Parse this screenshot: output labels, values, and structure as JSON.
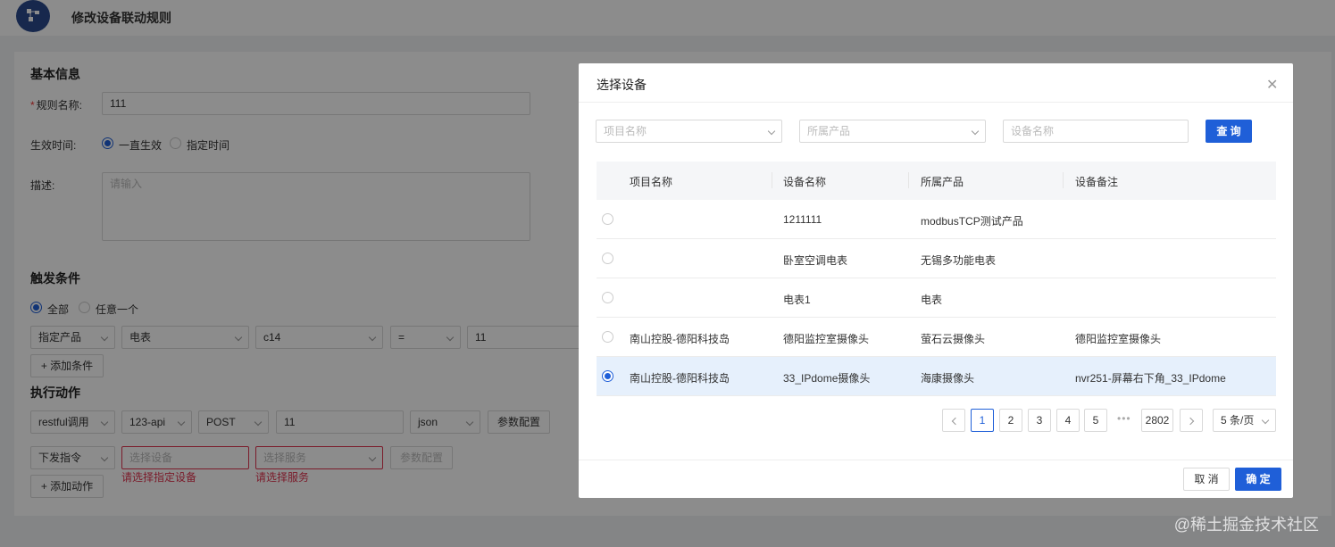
{
  "header": {
    "title": "修改设备联动规则",
    "logo_icon": "flow-icon"
  },
  "form": {
    "basic_title": "基本信息",
    "rule_name_label": "规则名称:",
    "rule_name_value": "111",
    "effective_label": "生效时间:",
    "effective_options": [
      "一直生效",
      "指定时间"
    ],
    "desc_label": "描述:",
    "desc_placeholder": "请输入",
    "trigger_title": "触发条件",
    "trigger_options": [
      "全部",
      "任意一个"
    ],
    "trigger_row": [
      "指定产品",
      "电表",
      "c14",
      "=",
      "11"
    ],
    "add_condition": "+ 添加条件",
    "action_title": "执行动作",
    "action_row1": [
      "restful调用",
      "123-api",
      "POST",
      "11",
      "json"
    ],
    "param_button": "参数配置",
    "action_row2_type": "下发指令",
    "select_device_ph": "选择设备",
    "select_service_ph": "选择服务",
    "error_device": "请选择指定设备",
    "error_service": "请选择服务",
    "add_action": "+ 添加动作"
  },
  "modal": {
    "title": "选择设备",
    "filters": {
      "project_ph": "项目名称",
      "product_ph": "所属产品",
      "device_ph": "设备名称",
      "query_button": "查 询"
    },
    "columns": [
      "项目名称",
      "设备名称",
      "所属产品",
      "设备备注"
    ],
    "rows": [
      {
        "project": "",
        "device": "1211111",
        "product": "modbusTCP测试产品",
        "remark": ""
      },
      {
        "project": "",
        "device": "卧室空调电表",
        "product": "无锡多功能电表",
        "remark": ""
      },
      {
        "project": "",
        "device": "电表1",
        "product": "电表",
        "remark": ""
      },
      {
        "project": "南山控股-德阳科技岛",
        "device": "德阳监控室摄像头",
        "product": "萤石云摄像头",
        "remark": "德阳监控室摄像头"
      },
      {
        "project": "南山控股-德阳科技岛",
        "device": "33_IPdome摄像头",
        "product": "海康摄像头",
        "remark": "nvr251-屏幕右下角_33_IPdome"
      }
    ],
    "selected_row": 5,
    "pagination": {
      "pages": [
        "1",
        "2",
        "3",
        "4",
        "5"
      ],
      "ellipsis": "•••",
      "last": "2802",
      "page_size": "5 条/页"
    },
    "cancel": "取 消",
    "ok": "确 定"
  },
  "watermark": "@稀土掘金技术社区",
  "colors": {
    "primary": "#1f5fd8",
    "error": "#e0334f",
    "selected_row": "#e6f0fc"
  }
}
